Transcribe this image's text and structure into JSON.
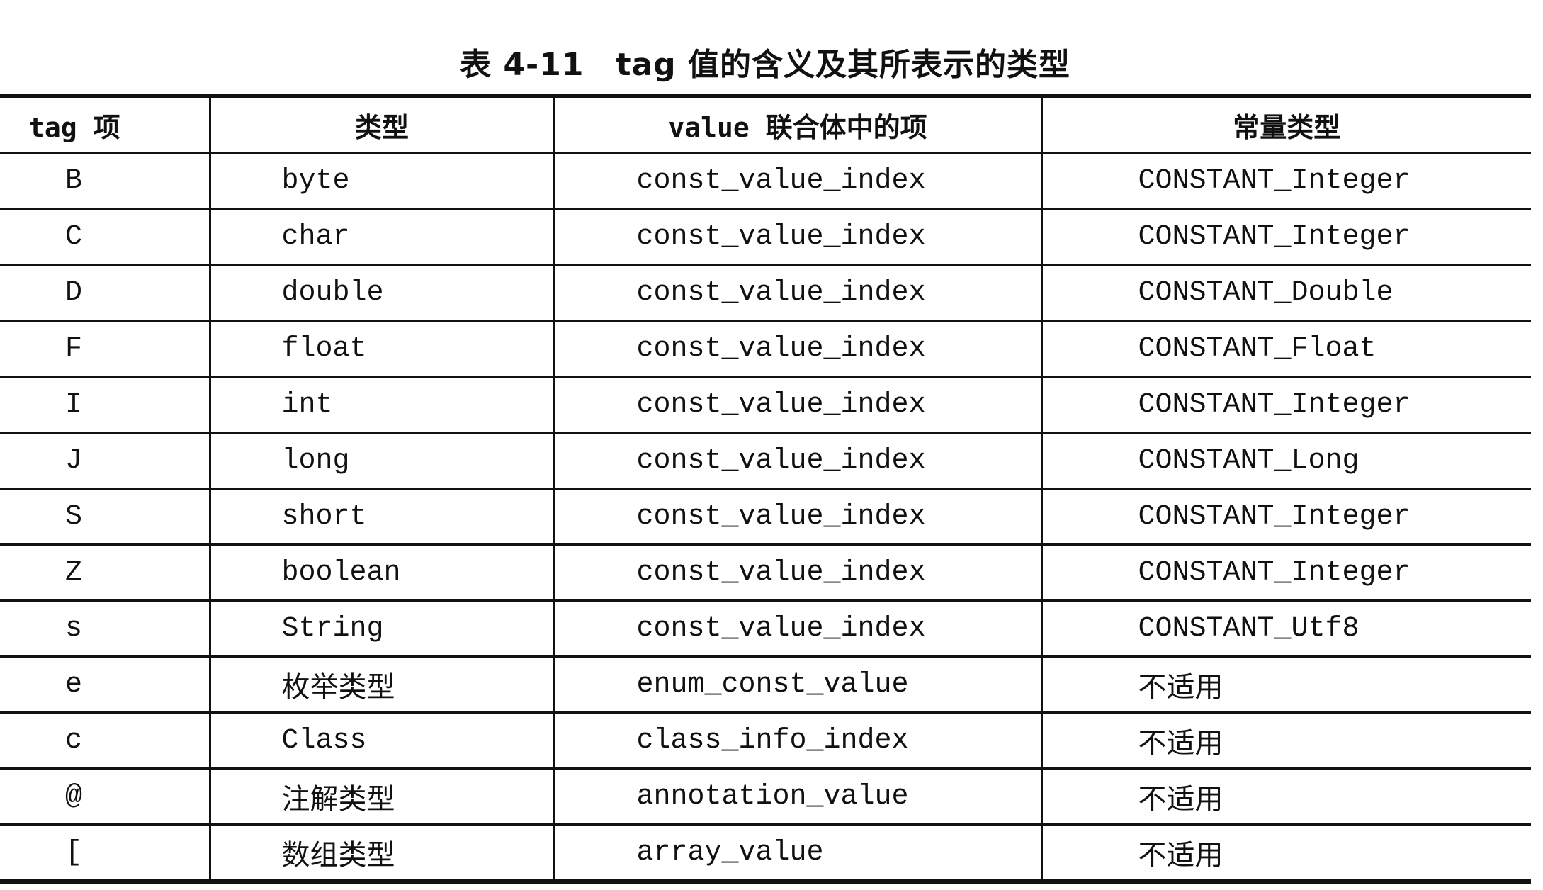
{
  "title": "表 4-11　tag 值的含义及其所表示的类型",
  "headers": [
    "tag 项",
    "类型",
    "value 联合体中的项",
    "常量类型"
  ],
  "rows": [
    [
      "B",
      "byte",
      "const_value_index",
      "CONSTANT_Integer"
    ],
    [
      "C",
      "char",
      "const_value_index",
      "CONSTANT_Integer"
    ],
    [
      "D",
      "double",
      "const_value_index",
      "CONSTANT_Double"
    ],
    [
      "F",
      "float",
      "const_value_index",
      "CONSTANT_Float"
    ],
    [
      "I",
      "int",
      "const_value_index",
      "CONSTANT_Integer"
    ],
    [
      "J",
      "long",
      "const_value_index",
      "CONSTANT_Long"
    ],
    [
      "S",
      "short",
      "const_value_index",
      "CONSTANT_Integer"
    ],
    [
      "Z",
      "boolean",
      "const_value_index",
      "CONSTANT_Integer"
    ],
    [
      "s",
      "String",
      "const_value_index",
      "CONSTANT_Utf8"
    ],
    [
      "e",
      "枚举类型",
      "enum_const_value",
      "不适用"
    ],
    [
      "c",
      "Class",
      "class_info_index",
      "不适用"
    ],
    [
      "@",
      "注解类型",
      "annotation_value",
      "不适用"
    ],
    [
      "[",
      "数组类型",
      "array_value",
      "不适用"
    ]
  ]
}
